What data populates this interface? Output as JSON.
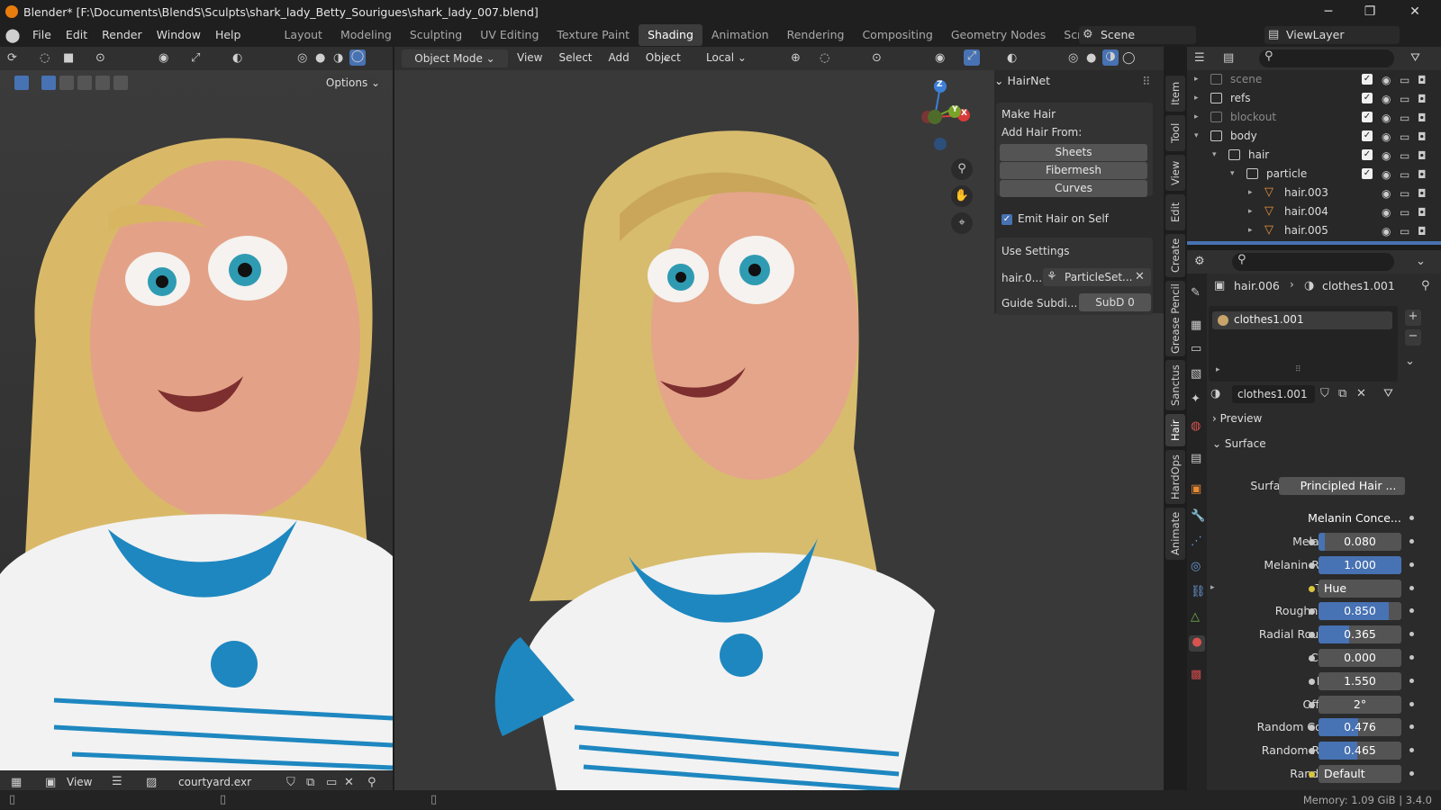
{
  "window": {
    "title": "Blender* [F:\\Documents\\BlendS\\Sculpts\\shark_lady_Betty_Sourigues\\shark_lady_007.blend]",
    "min_glyph": "─",
    "max_glyph": "❐",
    "close_glyph": "✕"
  },
  "menu": [
    "File",
    "Edit",
    "Render",
    "Window",
    "Help"
  ],
  "workspaces": [
    "Layout",
    "Modeling",
    "Sculpting",
    "UV Editing",
    "Texture Paint",
    "Shading",
    "Animation",
    "Rendering",
    "Compositing",
    "Geometry Nodes",
    "Scripting"
  ],
  "active_workspace": "Shading",
  "scene_name": "Scene",
  "view_layer": "ViewLayer",
  "left_viewport": {
    "options_label": "Options",
    "view_label": "View",
    "image_name": "courtyard.exr"
  },
  "viewport": {
    "mode": "Object Mode",
    "menus": [
      "View",
      "Select",
      "Add",
      "Object"
    ],
    "transform_space": "Local",
    "gizmo": {
      "z": "Z",
      "y": "Y",
      "x": "X"
    }
  },
  "hairnet": {
    "title": "HairNet",
    "make_hair": "Make Hair",
    "add_from": "Add Hair From:",
    "buttons": [
      "Sheets",
      "Fibermesh",
      "Curves"
    ],
    "emit_label": "Emit Hair on Self",
    "emit_checked": true,
    "use_settings": "Use Settings",
    "settings_obj": "hair.0...",
    "particle_set": "ParticleSet...",
    "guide_label": "Guide Subdi...",
    "guide_value": "SubD   0"
  },
  "side_tabs": [
    "Item",
    "Tool",
    "View",
    "Edit",
    "Create",
    "Grease Pencil",
    "Sanctus",
    "Hair",
    "HardOps",
    "Animate"
  ],
  "active_side_tab": "Hair",
  "outliner": {
    "rows": [
      {
        "name": "scene",
        "dim": true,
        "indent": 0,
        "expand": "▸"
      },
      {
        "name": "refs",
        "dim": false,
        "indent": 0,
        "expand": "▸"
      },
      {
        "name": "blockout",
        "dim": true,
        "indent": 0,
        "expand": "▸"
      },
      {
        "name": "body",
        "dim": false,
        "indent": 0,
        "expand": "▾"
      },
      {
        "name": "hair",
        "dim": false,
        "indent": 1,
        "expand": "▾"
      },
      {
        "name": "particle",
        "dim": false,
        "indent": 2,
        "expand": "▾"
      },
      {
        "name": "hair.003",
        "dim": false,
        "indent": 3,
        "expand": "▸",
        "mesh": true
      },
      {
        "name": "hair.004",
        "dim": false,
        "indent": 3,
        "expand": "▸",
        "mesh": true
      },
      {
        "name": "hair.005",
        "dim": false,
        "indent": 3,
        "expand": "▸",
        "mesh": true
      }
    ]
  },
  "properties": {
    "breadcrumb_obj": "hair.006",
    "breadcrumb_mat": "clothes1.001",
    "slot_name": "clothes1.001",
    "material_name": "clothes1.001",
    "preview": "Preview",
    "surface_section": "Surface",
    "surface_label": "Surface",
    "surface_value": "Principled Hair ...",
    "parametrization": "Melanin Conce...",
    "fields": [
      {
        "label": "Melanin",
        "value": "0.080",
        "fill": 0.08
      },
      {
        "label": "Melanin Re...",
        "value": "1.000",
        "fill": 1.0
      },
      {
        "label": "Tint",
        "value": "Hue Saturation...",
        "fill": null,
        "link": true
      },
      {
        "label": "Roughness",
        "value": "0.850",
        "fill": 0.85
      },
      {
        "label": "Radial Roug...",
        "value": "0.365",
        "fill": 0.365
      },
      {
        "label": "Coat",
        "value": "0.000",
        "fill": 0.0
      },
      {
        "label": "IOR",
        "value": "1.550",
        "fill": null
      },
      {
        "label": "Offset",
        "value": "2°",
        "fill": null
      },
      {
        "label": "Random Color",
        "value": "0.476",
        "fill": 0.476
      },
      {
        "label": "Random Ro...",
        "value": "0.465",
        "fill": 0.465
      },
      {
        "label": "Random",
        "value": "Default",
        "fill": null,
        "link": true
      }
    ]
  },
  "status": "Memory: 1.09 GiB | 3.4.0",
  "colors": {
    "accent": "#4772b3",
    "orange": "#e87d0d",
    "bg": "#1d1d1d",
    "panel": "#2b2b2b",
    "header": "#303030"
  }
}
